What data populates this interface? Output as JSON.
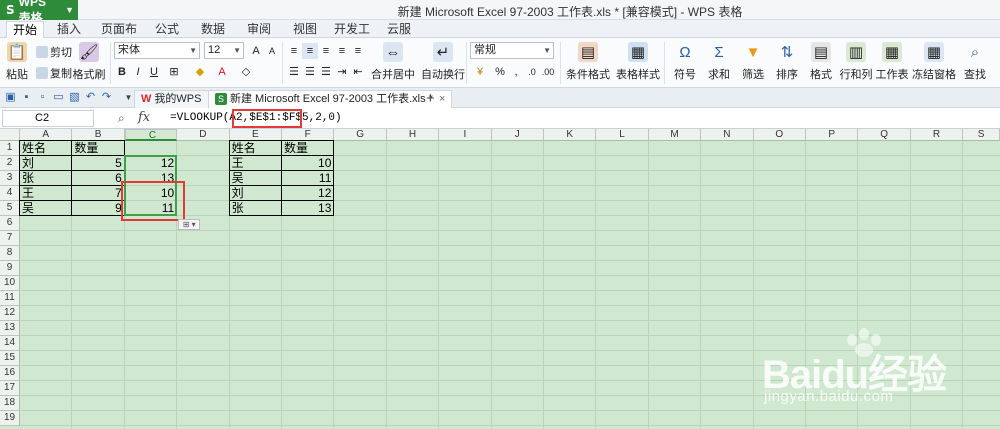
{
  "app": {
    "logo_label": "WPS 表格",
    "window_title": "新建 Microsoft Excel 97-2003 工作表.xls * [兼容模式] - WPS 表格"
  },
  "menu": {
    "tabs": [
      "开始",
      "插入",
      "页面布局",
      "公式",
      "数据",
      "审阅",
      "视图",
      "开发工具",
      "云服务"
    ],
    "active": "开始"
  },
  "ribbon": {
    "paste": "粘贴",
    "cut": "剪切",
    "copy": "复制",
    "format_painter": "格式刷",
    "font_name": "宋体",
    "font_size": "12",
    "merge_center": "合并居中",
    "auto_wrap": "自动换行",
    "number_format": "常规",
    "cond_format": "条件格式",
    "table_style": "表格样式",
    "symbol": "符号",
    "sum": "求和",
    "filter": "筛选",
    "sort": "排序",
    "format": "格式",
    "row_col": "行和列",
    "worksheet": "工作表",
    "freeze": "冻结窗格",
    "find": "查找",
    "bold": "B",
    "italic": "I",
    "underline": "U",
    "percent": "%",
    "comma": ","
  },
  "doctabs": [
    {
      "label": "我的WPS"
    },
    {
      "label": "新建 Microsoft Excel 97-2003 工作表.xls *"
    }
  ],
  "formula_bar": {
    "cell_ref": "C2",
    "fx": "fx",
    "formula": "=VLOOKUP(A2,$E$1:$F$5,2,0)"
  },
  "sheet": {
    "columns": [
      "A",
      "B",
      "C",
      "D",
      "E",
      "F",
      "G",
      "H",
      "I",
      "J",
      "K",
      "L",
      "M",
      "N",
      "O",
      "P",
      "Q",
      "R",
      "S"
    ],
    "rows": [
      "1",
      "2",
      "3",
      "4",
      "5",
      "6",
      "7",
      "8",
      "9",
      "10",
      "11",
      "12",
      "13",
      "14",
      "15",
      "16",
      "17",
      "18",
      "19"
    ],
    "left_table": {
      "headers": [
        "姓名",
        "数量"
      ],
      "rows": [
        {
          "name": "刘",
          "qty": "5",
          "lookup": "12"
        },
        {
          "name": "张",
          "qty": "6",
          "lookup": "13"
        },
        {
          "name": "王",
          "qty": "7",
          "lookup": "10"
        },
        {
          "name": "吴",
          "qty": "9",
          "lookup": "11"
        }
      ]
    },
    "right_table": {
      "headers": [
        "姓名",
        "数量"
      ],
      "rows": [
        {
          "name": "王",
          "qty": "10"
        },
        {
          "name": "吴",
          "qty": "11"
        },
        {
          "name": "刘",
          "qty": "12"
        },
        {
          "name": "张",
          "qty": "13"
        }
      ]
    }
  },
  "watermark": {
    "brand": "Baidu经验",
    "url": "jingyan.baidu.com"
  }
}
